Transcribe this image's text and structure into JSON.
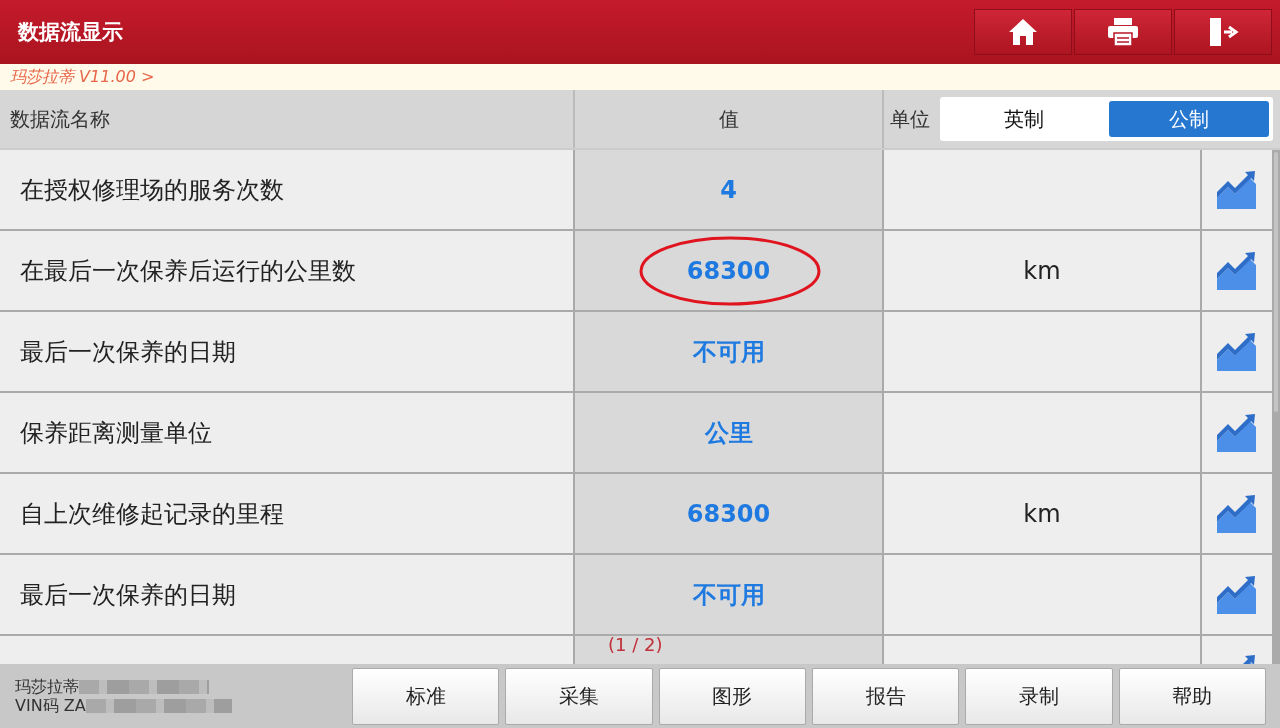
{
  "window": {
    "title": "数据流显示"
  },
  "breadcrumb": "玛莎拉蒂 V11.00 >",
  "table": {
    "columns": [
      "数据流名称",
      "值",
      "单位"
    ],
    "unit_options": [
      {
        "label": "英制",
        "selected": false
      },
      {
        "label": "公制",
        "selected": true
      }
    ],
    "rows": [
      {
        "name": "在授权修理场的服务次数",
        "value": "4",
        "unit": "",
        "circled": false
      },
      {
        "name": "在最后一次保养后运行的公里数",
        "value": "68300",
        "unit": "km",
        "circled": true
      },
      {
        "name": "最后一次保养的日期",
        "value": "不可用",
        "unit": "",
        "circled": false
      },
      {
        "name": "保养距离测量单位",
        "value": "公里",
        "unit": "",
        "circled": false
      },
      {
        "name": "自上次维修起记录的里程",
        "value": "68300",
        "unit": "km",
        "circled": false
      },
      {
        "name": "最后一次保养的日期",
        "value": "不可用",
        "unit": "",
        "circled": false
      }
    ],
    "page_indicator": "(1 / 2)"
  },
  "footer": {
    "vehicle": "玛莎拉蒂",
    "vin": "VIN码 ZA",
    "buttons": [
      "标准",
      "采集",
      "图形",
      "报告",
      "录制",
      "帮助"
    ]
  }
}
